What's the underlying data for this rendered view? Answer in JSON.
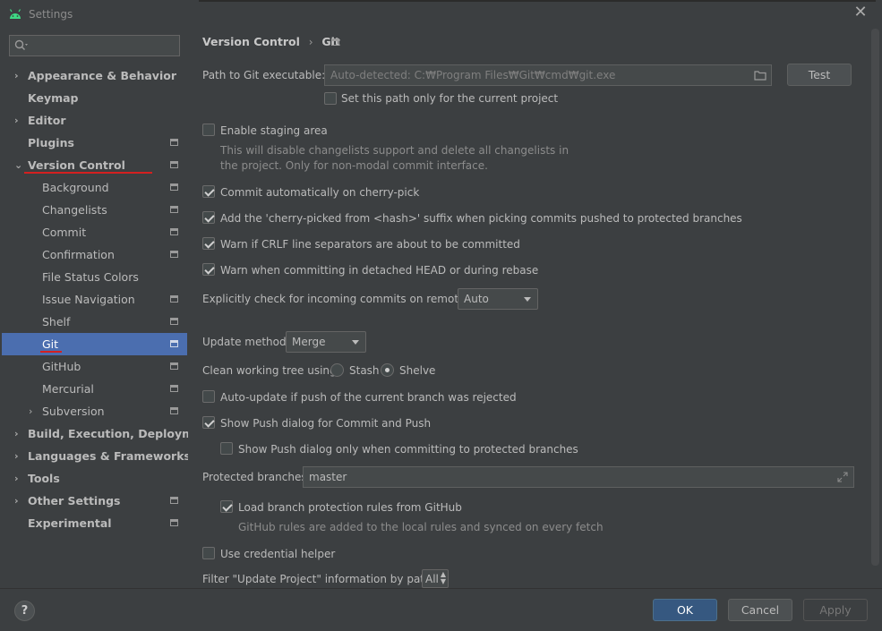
{
  "window": {
    "title": "Settings",
    "close_label": "✕"
  },
  "sidebar": {
    "search_placeholder": "",
    "items": [
      {
        "label": "Appearance & Behavior"
      },
      {
        "label": "Keymap"
      },
      {
        "label": "Editor"
      },
      {
        "label": "Plugins"
      },
      {
        "label": "Version Control"
      },
      {
        "label": "Background"
      },
      {
        "label": "Changelists"
      },
      {
        "label": "Commit"
      },
      {
        "label": "Confirmation"
      },
      {
        "label": "File Status Colors"
      },
      {
        "label": "Issue Navigation"
      },
      {
        "label": "Shelf"
      },
      {
        "label": "Git"
      },
      {
        "label": "GitHub"
      },
      {
        "label": "Mercurial"
      },
      {
        "label": "Subversion"
      },
      {
        "label": "Build, Execution, Deployment"
      },
      {
        "label": "Languages & Frameworks"
      },
      {
        "label": "Tools"
      },
      {
        "label": "Other Settings"
      },
      {
        "label": "Experimental"
      }
    ],
    "selected": "Git"
  },
  "breadcrumb": {
    "parent": "Version Control",
    "separator": "›",
    "current": "Git"
  },
  "git_path": {
    "label": "Path to Git executable:",
    "value": "Auto-detected: C:₩Program Files₩Git₩cmd₩git.exe",
    "test_button": "Test",
    "current_project_only": {
      "label": "Set this path only for the current project",
      "checked": false
    }
  },
  "staging": {
    "label": "Enable staging area",
    "checked": false,
    "hint_line1": "This will disable changelists support and delete all changelists in",
    "hint_line2": "the project. Only for non-modal commit interface."
  },
  "options": {
    "cherry_pick": {
      "label": "Commit automatically on cherry-pick",
      "checked": true
    },
    "cherry_suffix": {
      "label": "Add the 'cherry-picked from <hash>' suffix when picking commits pushed to protected branches",
      "checked": true
    },
    "crlf": {
      "label": "Warn if CRLF line separators are about to be committed",
      "checked": true
    },
    "detached": {
      "label": "Warn when committing in detached HEAD or during rebase",
      "checked": true
    }
  },
  "incoming": {
    "label": "Explicitly check for incoming commits on remotes:",
    "value": "Auto"
  },
  "update_method": {
    "label": "Update method:",
    "value": "Merge"
  },
  "clean_tree": {
    "label": "Clean working tree using:",
    "stash": "Stash",
    "shelve": "Shelve",
    "selected": "Shelve"
  },
  "auto_update": {
    "label": "Auto-update if push of the current branch was rejected",
    "checked": false
  },
  "push_dialog": {
    "label": "Show Push dialog for Commit and Push",
    "checked": true
  },
  "push_dialog_protected": {
    "label": "Show Push dialog only when committing to protected branches",
    "checked": false
  },
  "protected": {
    "label": "Protected branches:",
    "value": "master"
  },
  "github_rules": {
    "label": "Load branch protection rules from GitHub",
    "checked": true,
    "hint": "GitHub rules are added to the local rules and synced on every fetch"
  },
  "credential": {
    "label": "Use credential helper",
    "checked": false
  },
  "filter": {
    "label": "Filter \"Update Project\" information by paths:",
    "value": "All"
  },
  "footer": {
    "help": "?",
    "ok": "OK",
    "cancel": "Cancel",
    "apply": "Apply"
  },
  "colors": {
    "selection": "#4b6eaf",
    "ok_button": "#365880",
    "annotation_underline": "#d42020"
  }
}
